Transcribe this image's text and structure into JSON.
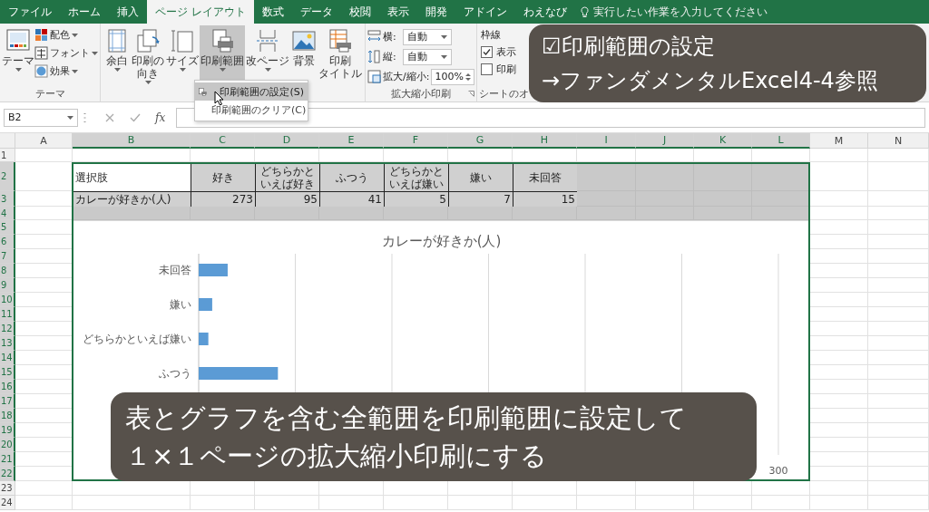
{
  "ribbon": {
    "tabs": [
      {
        "label": "ファイル",
        "selected": false
      },
      {
        "label": "ホーム",
        "selected": false
      },
      {
        "label": "挿入",
        "selected": false
      },
      {
        "label": "ページ レイアウト",
        "selected": true
      },
      {
        "label": "数式",
        "selected": false
      },
      {
        "label": "データ",
        "selected": false
      },
      {
        "label": "校閲",
        "selected": false
      },
      {
        "label": "表示",
        "selected": false
      },
      {
        "label": "開発",
        "selected": false
      },
      {
        "label": "アドイン",
        "selected": false
      },
      {
        "label": "わえなび",
        "selected": false
      }
    ],
    "tell_me": {
      "placeholder": "実行したい作業を入力してください"
    },
    "theme_group": {
      "label": "テーマ",
      "button": "テーマ",
      "items": [
        {
          "kind": "colors",
          "label": "配色"
        },
        {
          "kind": "fonts",
          "label": "フォント"
        },
        {
          "kind": "effects",
          "label": "効果"
        }
      ]
    },
    "page_setup": {
      "buttons": [
        {
          "kind": "margins",
          "label": [
            "余白"
          ],
          "pressed": false,
          "dropdown": true
        },
        {
          "kind": "orientation",
          "label": [
            "印刷の",
            "向き"
          ],
          "pressed": false,
          "dropdown": true
        },
        {
          "kind": "size",
          "label": [
            "サイズ"
          ],
          "pressed": false,
          "dropdown": true
        },
        {
          "kind": "print_area",
          "label": [
            "印刷範囲"
          ],
          "pressed": true,
          "dropdown": true
        },
        {
          "kind": "breaks",
          "label": [
            "改ページ"
          ],
          "pressed": false,
          "dropdown": true
        },
        {
          "kind": "background",
          "label": [
            "背景"
          ],
          "pressed": false,
          "dropdown": false
        },
        {
          "kind": "print_titles",
          "label": [
            "印刷",
            "タイトル"
          ],
          "pressed": false,
          "dropdown": false
        }
      ]
    },
    "scale": {
      "label": "拡大縮小印刷",
      "fields": [
        {
          "kind": "width",
          "label": "横:",
          "value": "自動"
        },
        {
          "kind": "height",
          "label": "縦:",
          "value": "自動"
        },
        {
          "kind": "scale",
          "label": "拡大/縮小:",
          "value": "100%"
        }
      ]
    },
    "sheet_options": {
      "label": "シートのオ",
      "heading": "枠線",
      "checks": [
        {
          "label": "表示",
          "checked": true
        },
        {
          "label": "印刷",
          "checked": false
        }
      ]
    }
  },
  "dropdown_menu": {
    "items": [
      {
        "label": "印刷範囲の設定(S)",
        "selected": true
      },
      {
        "label": "印刷範囲のクリア(C)",
        "selected": false
      }
    ]
  },
  "formula_bar": {
    "name_box": "B2",
    "function_label": "fx"
  },
  "sheet": {
    "columns": [
      {
        "label": "A",
        "selected": false
      },
      {
        "label": "B",
        "selected": true
      },
      {
        "label": "C",
        "selected": true
      },
      {
        "label": "D",
        "selected": true
      },
      {
        "label": "E",
        "selected": true
      },
      {
        "label": "F",
        "selected": true
      },
      {
        "label": "G",
        "selected": true
      },
      {
        "label": "H",
        "selected": true
      },
      {
        "label": "I",
        "selected": true
      },
      {
        "label": "J",
        "selected": true
      },
      {
        "label": "K",
        "selected": true
      },
      {
        "label": "L",
        "selected": true
      },
      {
        "label": "M",
        "selected": false
      },
      {
        "label": "N",
        "selected": false
      }
    ],
    "rows": [
      {
        "label": "1",
        "selected": false
      },
      {
        "label": "2",
        "selected": true
      },
      {
        "label": "3",
        "selected": true
      },
      {
        "label": "4",
        "selected": true
      },
      {
        "label": "5",
        "selected": true
      },
      {
        "label": "6",
        "selected": true
      },
      {
        "label": "7",
        "selected": true
      },
      {
        "label": "8",
        "selected": true
      },
      {
        "label": "9",
        "selected": true
      },
      {
        "label": "10",
        "selected": true
      },
      {
        "label": "11",
        "selected": true
      },
      {
        "label": "12",
        "selected": true
      },
      {
        "label": "13",
        "selected": true
      },
      {
        "label": "14",
        "selected": true
      },
      {
        "label": "15",
        "selected": true
      },
      {
        "label": "16",
        "selected": true
      },
      {
        "label": "17",
        "selected": true
      },
      {
        "label": "18",
        "selected": true
      },
      {
        "label": "19",
        "selected": true
      },
      {
        "label": "20",
        "selected": true
      },
      {
        "label": "21",
        "selected": true
      },
      {
        "label": "22",
        "selected": true
      },
      {
        "label": "23",
        "selected": false
      },
      {
        "label": "24",
        "selected": false
      }
    ],
    "table": {
      "header": [
        {
          "text": [
            "選択肢"
          ],
          "active": true
        },
        {
          "text": [
            "好き"
          ],
          "active": false
        },
        {
          "text": [
            "どちらかと",
            "いえば好き"
          ],
          "active": false
        },
        {
          "text": [
            "ふつう"
          ],
          "active": false
        },
        {
          "text": [
            "どちらかと",
            "いえば嫌い"
          ],
          "active": false
        },
        {
          "text": [
            "嫌い"
          ],
          "active": false
        },
        {
          "text": [
            "未回答"
          ],
          "active": false
        }
      ],
      "rows": [
        [
          "カレーが好きか(人)",
          "273",
          "95",
          "41",
          "5",
          "7",
          "15"
        ]
      ]
    },
    "chart": {
      "chart_data": {
        "type": "bar",
        "orientation": "horizontal",
        "title": "カレーが好きか(人)",
        "categories": [
          "未回答",
          "嫌い",
          "どちらかといえば嫌い",
          "ふつう"
        ],
        "series": [
          {
            "color": "#5b9bd5",
            "values": [
              15,
              7,
              5,
              41
            ]
          }
        ],
        "xlim": [
          0,
          300
        ],
        "xticks": [
          0,
          50,
          100,
          150,
          200,
          250,
          300
        ],
        "grid": true
      }
    }
  },
  "captions": [
    {
      "lines": [
        "☑印刷範囲の設定",
        "→ファンダメンタルExcel4-4参照"
      ]
    },
    {
      "lines": [
        "表とグラフを含む全範囲を印刷範囲に設定して",
        "１×１ページの拡大縮小印刷にする"
      ]
    }
  ]
}
